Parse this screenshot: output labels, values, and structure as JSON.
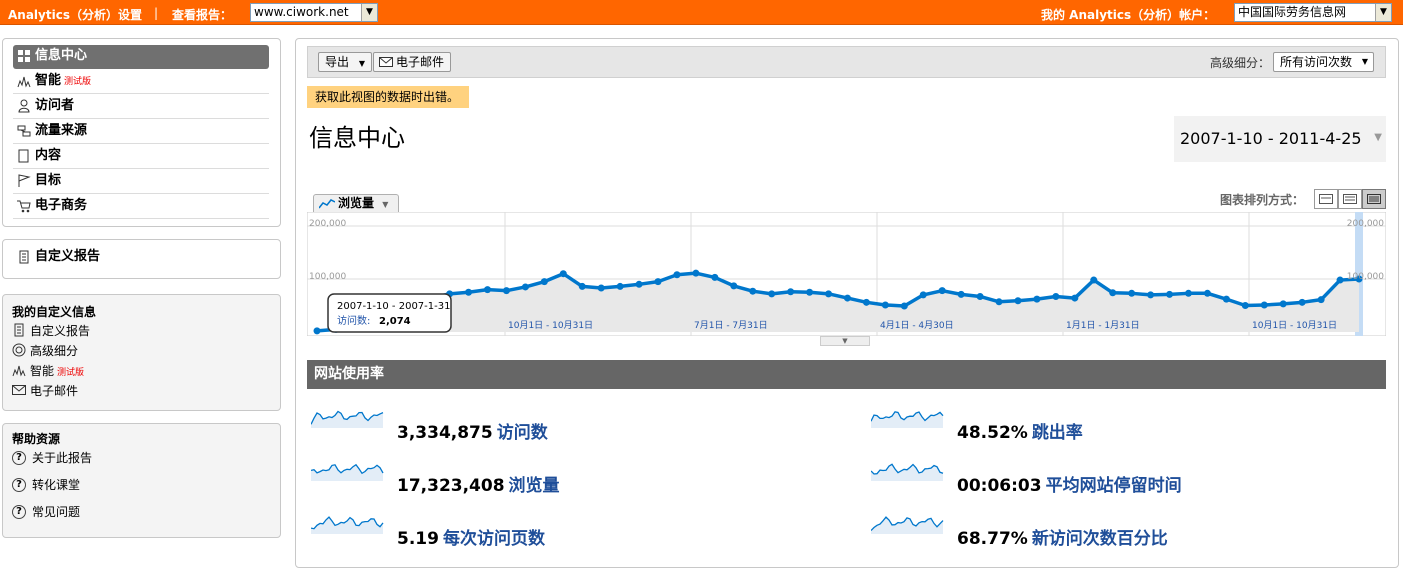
{
  "topbar": {
    "analytics_settings": "Analytics（分析）设置",
    "separator": "|",
    "view_reports_label": "查看报告：",
    "site_select_value": "www.ciwork.net",
    "my_account_label": "我的 Analytics（分析）帐户：",
    "account_select_value": "中国国际劳务信息网"
  },
  "nav": {
    "items": [
      {
        "label": "信息中心",
        "icon": "dashboard-icon",
        "beta": ""
      },
      {
        "label": "智能",
        "icon": "intelligence-icon",
        "beta": "测试版"
      },
      {
        "label": "访问者",
        "icon": "visitors-icon",
        "beta": ""
      },
      {
        "label": "流量来源",
        "icon": "traffic-sources-icon",
        "beta": ""
      },
      {
        "label": "内容",
        "icon": "content-icon",
        "beta": ""
      },
      {
        "label": "目标",
        "icon": "goals-flag-icon",
        "beta": ""
      },
      {
        "label": "电子商务",
        "icon": "cart-icon",
        "beta": ""
      }
    ],
    "custom_reports": "自定义报告"
  },
  "my_custom": {
    "title": "我的自定义信息",
    "links": [
      {
        "label": "自定义报告",
        "icon": "report-icon",
        "beta": ""
      },
      {
        "label": "高级细分",
        "icon": "segment-icon",
        "beta": ""
      },
      {
        "label": "智能",
        "icon": "intelligence-icon",
        "beta": "测试版"
      },
      {
        "label": "电子邮件",
        "icon": "email-icon",
        "beta": ""
      }
    ]
  },
  "help": {
    "title": "帮助资源",
    "links": [
      {
        "label": "关于此报告",
        "icon": "help-icon"
      },
      {
        "label": "转化课堂",
        "icon": "help-icon"
      },
      {
        "label": "常见问题",
        "icon": "help-icon"
      }
    ]
  },
  "toolbar": {
    "export_label": "导出",
    "email_label": "电子邮件",
    "segment_label": "高级细分：",
    "segment_value": "所有访问次数"
  },
  "error_message": "获取此视图的数据时出错。",
  "page_title": "信息中心",
  "date_range": "2007-1-10 - 2011-4-25",
  "chart_tab": "浏览量",
  "chart_layout_label": "图表排列方式：",
  "tooltip": {
    "range": "2007-1-10 - 2007-1-31",
    "metric_label": "访问数:",
    "metric_value": "2,074"
  },
  "chart_data": {
    "type": "line",
    "y_ticks": [
      "200,000",
      "100,000"
    ],
    "ylim": [
      0,
      200000
    ],
    "x_tick_labels": [
      "10月1日 - 10月31日",
      "7月1日 - 7月31日",
      "4月1日 - 4月30日",
      "1月1日 - 1月31日",
      "10月1日 - 10月31日"
    ],
    "series": [
      {
        "name": "",
        "color": "#0077cc",
        "values": [
          2074,
          5000,
          35000,
          46000,
          55000,
          60000,
          64000,
          72000,
          75000,
          80000,
          78000,
          85000,
          95000,
          110000,
          86000,
          83000,
          86000,
          90000,
          95000,
          108000,
          111000,
          103000,
          87000,
          77000,
          72000,
          76000,
          75000,
          72000,
          64000,
          56000,
          51000,
          49000,
          70000,
          78000,
          71000,
          67000,
          57000,
          59000,
          62000,
          67000,
          64000,
          98000,
          74000,
          73000,
          70000,
          71000,
          73000,
          73000,
          62000,
          50000,
          51000,
          53000,
          56000,
          61000,
          98000,
          100000
        ]
      }
    ]
  },
  "usage": {
    "title": "网站使用率",
    "metrics": [
      {
        "value": "3,334,875",
        "label": "访问数"
      },
      {
        "value": "48.52%",
        "label": "跳出率"
      },
      {
        "value": "17,323,408",
        "label": "浏览量"
      },
      {
        "value": "00:06:03",
        "label": "平均网站停留时间"
      },
      {
        "value": "5.19",
        "label": "每次访问页数"
      },
      {
        "value": "68.77%",
        "label": "新访问次数百分比"
      }
    ]
  },
  "colors": {
    "topbar": "#ff6600",
    "line": "#0077cc",
    "header_dark": "#666666",
    "error_bg": "#ffd27f",
    "metric_label": "#1f4e99"
  }
}
